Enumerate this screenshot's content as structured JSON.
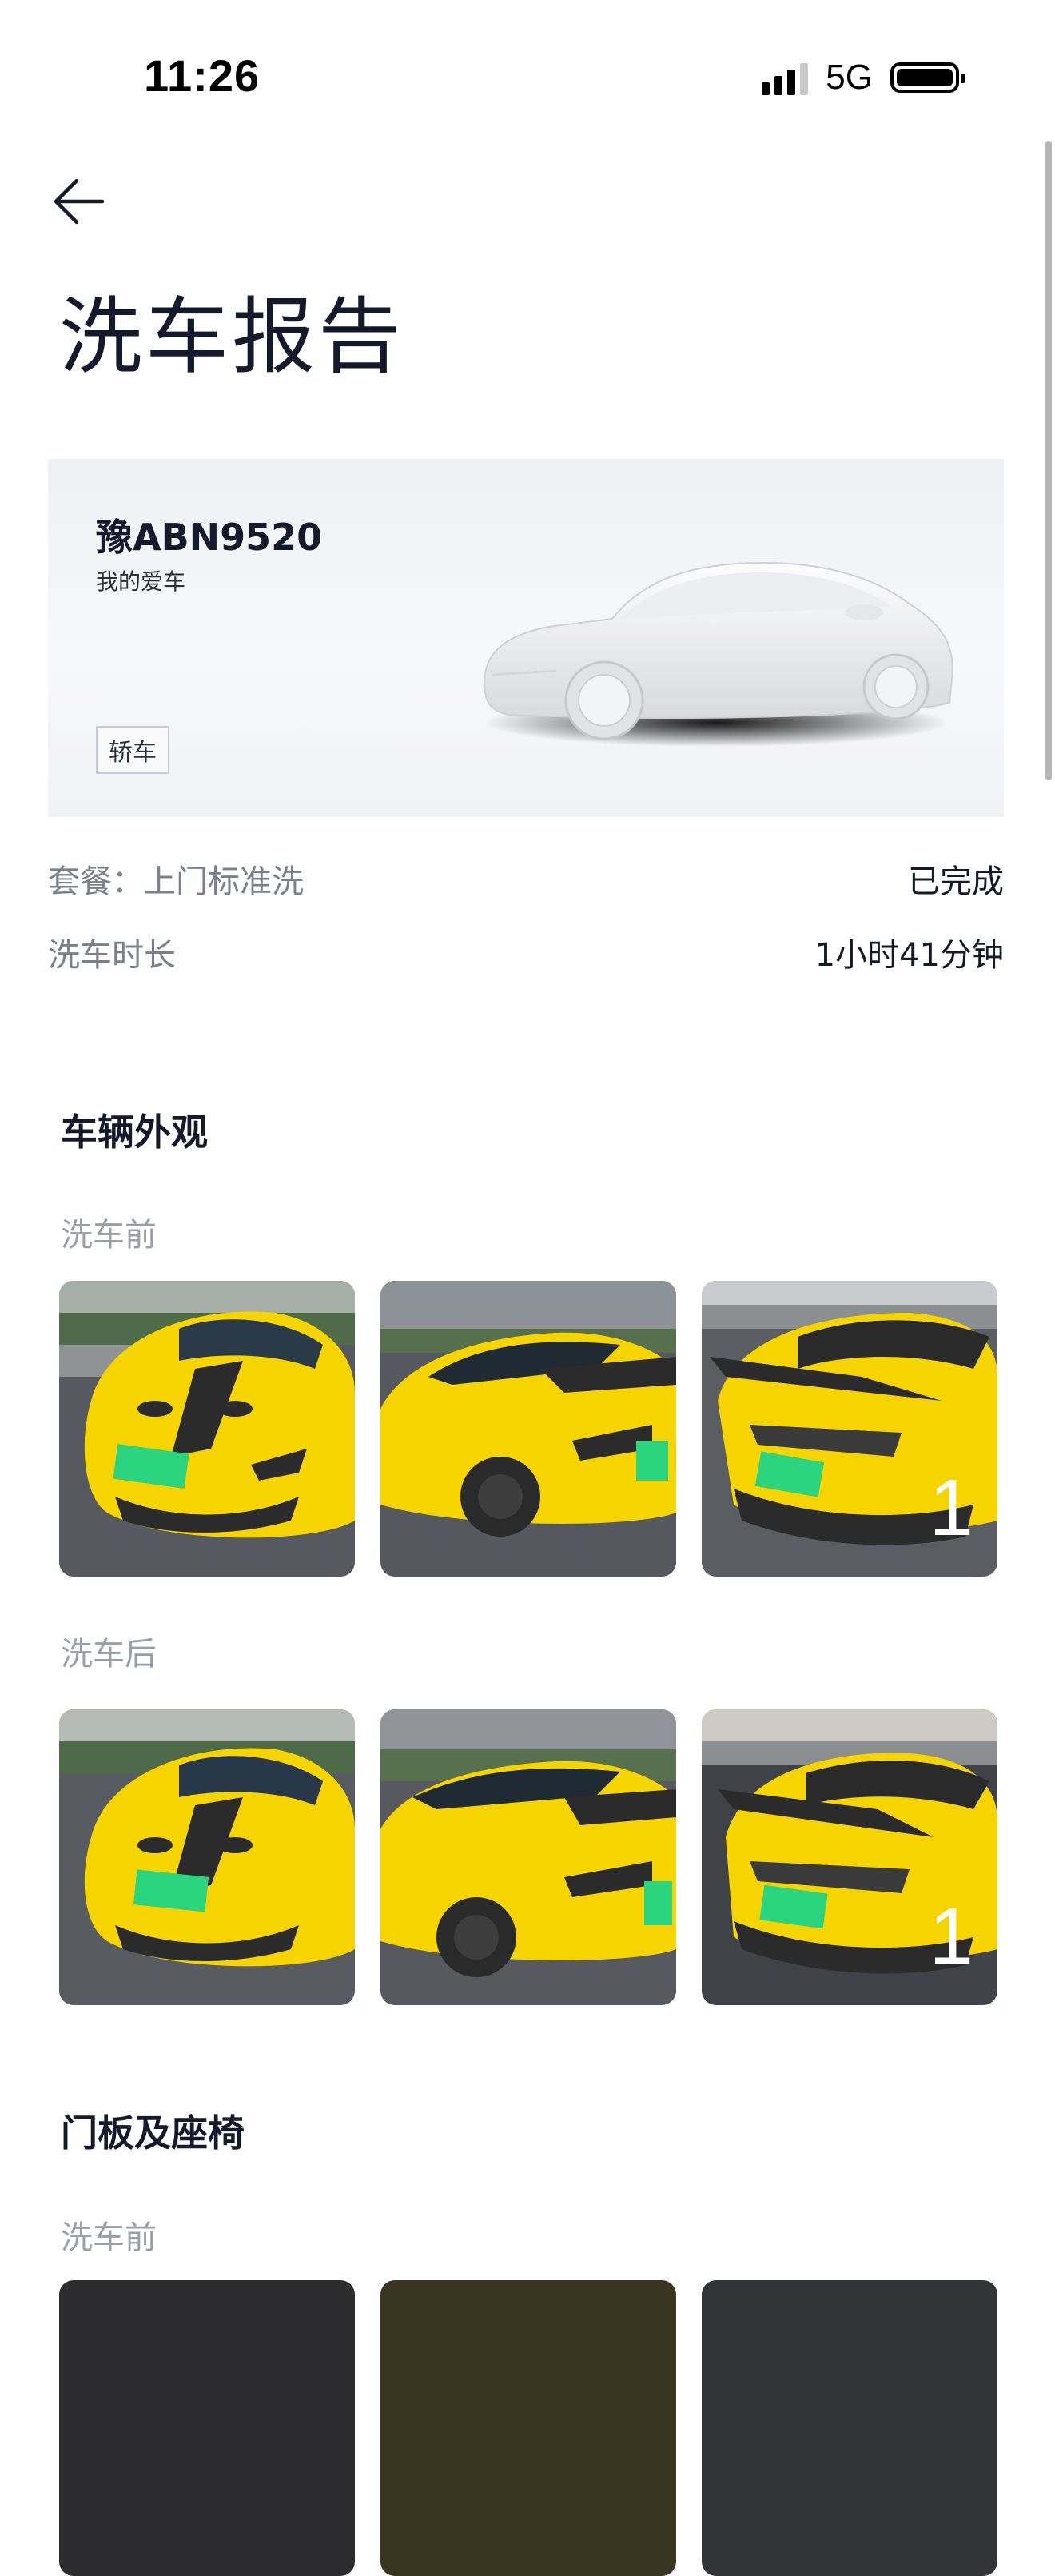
{
  "status_bar": {
    "time": "11:26",
    "network": "5G"
  },
  "header": {
    "back_icon": "arrow-left-icon",
    "title": "洗车报告"
  },
  "vehicle": {
    "plate": "豫ABN9520",
    "nickname": "我的爱车",
    "car_type": "轿车",
    "illustration": "white-sedan-3d-model"
  },
  "info": {
    "package_label": "套餐：上门标准洗",
    "status": "已完成",
    "duration_label": "洗车时长",
    "duration_value": "1小时41分钟"
  },
  "sections": [
    {
      "title": "车辆外观",
      "before_label": "洗车前",
      "after_label": "洗车后",
      "before_photos": [
        "front-view",
        "side-view",
        "rear-view"
      ],
      "after_photos": [
        "front-view",
        "side-view",
        "rear-view"
      ],
      "before_more_count": "1",
      "after_more_count": "1"
    },
    {
      "title": "门板及座椅",
      "before_label": "洗车前"
    }
  ],
  "colors": {
    "car_body": "#f5d400",
    "plate_green": "#2bd47e",
    "ground": "#4a4d52",
    "text_primary": "#141a2b",
    "text_secondary": "#7a7f8c",
    "text_muted": "#9a9ea8"
  }
}
